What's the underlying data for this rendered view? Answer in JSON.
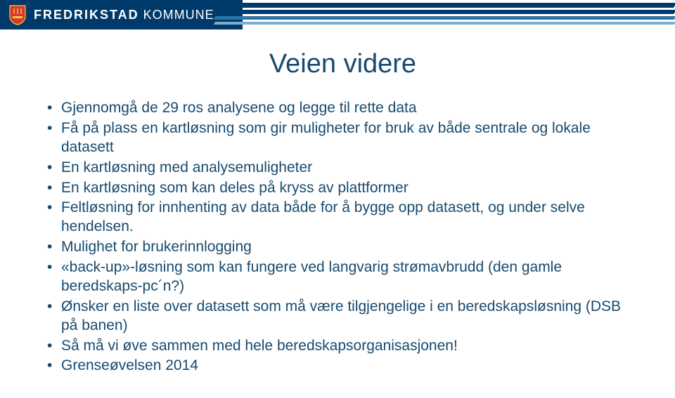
{
  "header": {
    "brand_strong": "FREDRIKSTAD",
    "brand_rest": " KOMMUNE"
  },
  "slide": {
    "title": "Veien videre",
    "bullets": [
      "Gjennomgå de 29 ros analysene og legge til rette data",
      "Få på plass en kartløsning som gir muligheter for bruk av både sentrale og lokale datasett",
      "En kartløsning med analysemuligheter",
      "En kartløsning som kan deles på kryss av plattformer",
      "Feltløsning for innhenting av data både for å bygge opp datasett, og under selve hendelsen.",
      "Mulighet for brukerinnlogging",
      "«back-up»-løsning som kan fungere ved langvarig strømavbrudd (den gamle beredskaps-pc´n?)",
      "Ønsker en liste over datasett som må være tilgjengelige i en beredskapsløsning (DSB på banen)",
      "Så må vi øve sammen med hele beredskapsorganisasjonen!",
      "Grenseøvelsen 2014"
    ]
  }
}
